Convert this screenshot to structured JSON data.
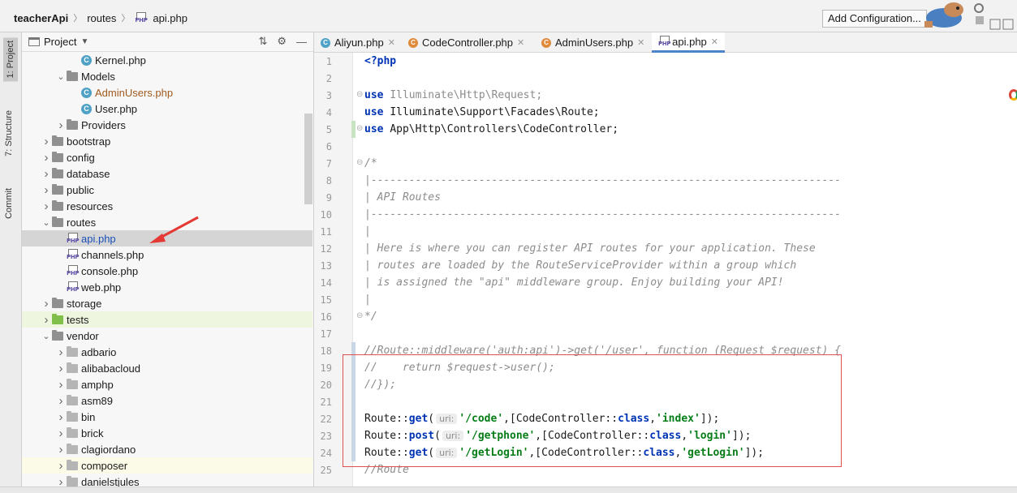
{
  "breadcrumb": {
    "project": "teacherApi",
    "folder": "routes",
    "file": "api.php"
  },
  "toolbar": {
    "add_configuration": "Add Configuration..."
  },
  "sidebar_tabs": {
    "project": "1: Project",
    "structure": "7: Structure",
    "commit": "Commit"
  },
  "project_panel": {
    "title": "Project",
    "tree": [
      {
        "label": "Kernel.php",
        "type": "class",
        "indent": 3,
        "color": "normal"
      },
      {
        "label": "Models",
        "type": "folder",
        "indent": 2,
        "expanded": true
      },
      {
        "label": "AdminUsers.php",
        "type": "class",
        "indent": 3,
        "color": "orange"
      },
      {
        "label": "User.php",
        "type": "class",
        "indent": 3,
        "color": "normal"
      },
      {
        "label": "Providers",
        "type": "folder",
        "indent": 2,
        "expanded": false
      },
      {
        "label": "bootstrap",
        "type": "folder",
        "indent": 1,
        "expanded": false
      },
      {
        "label": "config",
        "type": "folder",
        "indent": 1,
        "expanded": false
      },
      {
        "label": "database",
        "type": "folder",
        "indent": 1,
        "expanded": false
      },
      {
        "label": "public",
        "type": "folder",
        "indent": 1,
        "expanded": false
      },
      {
        "label": "resources",
        "type": "folder",
        "indent": 1,
        "expanded": false
      },
      {
        "label": "routes",
        "type": "folder",
        "indent": 1,
        "expanded": true
      },
      {
        "label": "api.php",
        "type": "php",
        "indent": 2,
        "selected": true
      },
      {
        "label": "channels.php",
        "type": "php",
        "indent": 2
      },
      {
        "label": "console.php",
        "type": "php",
        "indent": 2
      },
      {
        "label": "web.php",
        "type": "php",
        "indent": 2
      },
      {
        "label": "storage",
        "type": "folder",
        "indent": 1,
        "expanded": false
      },
      {
        "label": "tests",
        "type": "folder-green",
        "indent": 1,
        "expanded": false,
        "highlight": "green"
      },
      {
        "label": "vendor",
        "type": "folder",
        "indent": 1,
        "expanded": true
      },
      {
        "label": "adbario",
        "type": "lib",
        "indent": 2,
        "expanded": false
      },
      {
        "label": "alibabacloud",
        "type": "lib",
        "indent": 2,
        "expanded": false
      },
      {
        "label": "amphp",
        "type": "lib",
        "indent": 2,
        "expanded": false
      },
      {
        "label": "asm89",
        "type": "lib",
        "indent": 2,
        "expanded": false
      },
      {
        "label": "bin",
        "type": "lib",
        "indent": 2,
        "expanded": false
      },
      {
        "label": "brick",
        "type": "lib",
        "indent": 2,
        "expanded": false
      },
      {
        "label": "clagiordano",
        "type": "lib",
        "indent": 2,
        "expanded": false
      },
      {
        "label": "composer",
        "type": "lib",
        "indent": 2,
        "expanded": false,
        "highlight": "yellow"
      },
      {
        "label": "danielstjules",
        "type": "lib",
        "indent": 2,
        "expanded": false
      }
    ]
  },
  "tabs": [
    {
      "label": "Aliyun.php",
      "icon": "class"
    },
    {
      "label": "CodeController.php",
      "icon": "class-orange"
    },
    {
      "label": "AdminUsers.php",
      "icon": "class-orange"
    },
    {
      "label": "api.php",
      "icon": "php",
      "active": true
    }
  ],
  "code_lines": [
    {
      "n": "1",
      "text": "<?php"
    },
    {
      "n": "2",
      "text": ""
    },
    {
      "n": "3",
      "text": "use Illuminate\\Http\\Request;"
    },
    {
      "n": "4",
      "text": "use Illuminate\\Support\\Facades\\Route;"
    },
    {
      "n": "5",
      "text": "use App\\Http\\Controllers\\CodeController;"
    },
    {
      "n": "6",
      "text": ""
    },
    {
      "n": "7",
      "text": "/*"
    },
    {
      "n": "8",
      "text": "|--------------------------------------------------------------------------"
    },
    {
      "n": "9",
      "text": "| API Routes"
    },
    {
      "n": "10",
      "text": "|--------------------------------------------------------------------------"
    },
    {
      "n": "11",
      "text": "|"
    },
    {
      "n": "12",
      "text": "| Here is where you can register API routes for your application. These"
    },
    {
      "n": "13",
      "text": "| routes are loaded by the RouteServiceProvider within a group which"
    },
    {
      "n": "14",
      "text": "| is assigned the \"api\" middleware group. Enjoy building your API!"
    },
    {
      "n": "15",
      "text": "|"
    },
    {
      "n": "16",
      "text": "*/"
    },
    {
      "n": "17",
      "text": ""
    },
    {
      "n": "18",
      "text": "//Route::middleware('auth:api')->get('/user', function (Request $request) {"
    },
    {
      "n": "19",
      "text": "//    return $request->user();"
    },
    {
      "n": "20",
      "text": "//});"
    },
    {
      "n": "21",
      "text": ""
    },
    {
      "n": "22",
      "text": "Route::get( uri: '/code',[CodeController::class,'index']);"
    },
    {
      "n": "23",
      "text": "Route::post( uri: '/getphone',[CodeController::class,'login']);"
    },
    {
      "n": "24",
      "text": "Route::get( uri: '/getLogin',[CodeController::class,'getLogin']);"
    },
    {
      "n": "25",
      "text": "//Route"
    }
  ],
  "code_tokens": {
    "php_open": "<?php",
    "use": "use",
    "ns_request": "Illuminate\\Http\\Request;",
    "ns_route": "Illuminate\\Support\\Facades\\Route;",
    "ns_code": "App\\Http\\Controllers\\CodeController;",
    "route": "Route::",
    "get": "get",
    "post": "post",
    "paren_open": "(",
    "uri_hint": "uri:",
    "r1_path": "'/code'",
    "r2_path": "'/getphone'",
    "r3_path": "'/getLogin'",
    "mid": ",[CodeController::",
    "class_kw": "class",
    "comma": ",",
    "r1_action": "'index'",
    "r2_action": "'login'",
    "r3_action": "'getLogin'",
    "close": "]);"
  }
}
